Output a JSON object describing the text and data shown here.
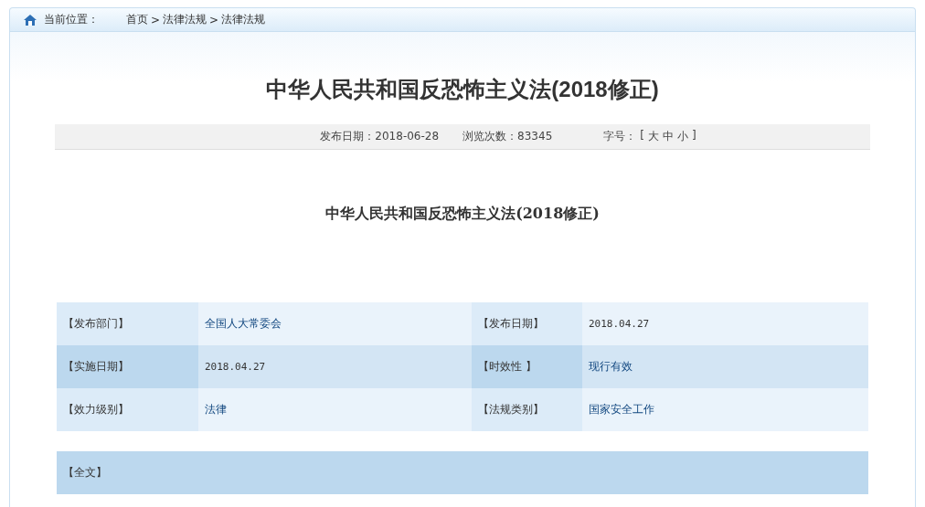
{
  "breadcrumb": {
    "label": "当前位置：",
    "items": [
      "首页",
      "法律法规",
      "法律法规"
    ],
    "separator": ">"
  },
  "title": "中华人民共和国反恐怖主义法(2018修正)",
  "meta": {
    "publish_date": "发布日期：2018-06-28",
    "views": "浏览次数：83345",
    "font_size": {
      "label": "字号：",
      "open": "[",
      "options": [
        "大",
        "中",
        "小"
      ],
      "close": "]"
    }
  },
  "subtitle": "中华人民共和国反恐怖主义法(2018修正)",
  "info_rows": [
    {
      "cells": [
        {
          "label": "【发布部门】",
          "value": "全国人大常委会",
          "kind": "link"
        },
        {
          "label": "【发布日期】",
          "value": "2018.04.27",
          "kind": "text"
        }
      ]
    },
    {
      "cells": [
        {
          "label": "【实施日期】",
          "value": "2018.04.27",
          "kind": "text"
        },
        {
          "label": "【时效性 】",
          "value": "现行有效",
          "kind": "link"
        }
      ]
    },
    {
      "cells": [
        {
          "label": "【效力级别】",
          "value": "法律",
          "kind": "link"
        },
        {
          "label": "【法规类别】",
          "value": "国家安全工作",
          "kind": "link"
        }
      ]
    }
  ],
  "full_text_header": "【全文】"
}
